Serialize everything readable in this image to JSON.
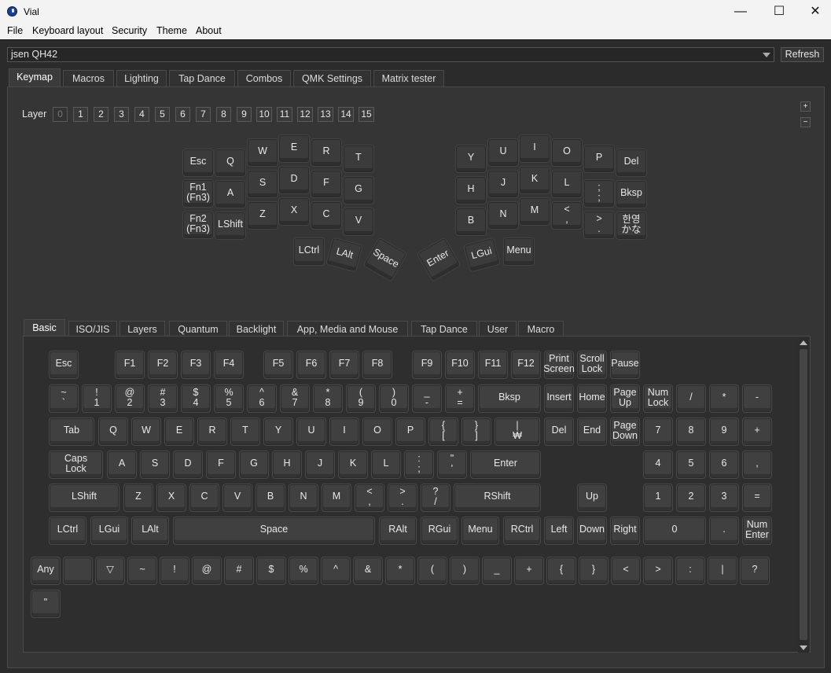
{
  "window": {
    "title": "Vial",
    "minimize": "—",
    "maximize": "☐",
    "close": "✕"
  },
  "menu": [
    "File",
    "Keyboard layout",
    "Security",
    "Theme",
    "About"
  ],
  "device": {
    "selected": "jsen QH42",
    "refresh_label": "Refresh"
  },
  "main_tabs": [
    "Keymap",
    "Macros",
    "Lighting",
    "Tap Dance",
    "Combos",
    "QMK Settings",
    "Matrix tester"
  ],
  "layer": {
    "label": "Layer",
    "buttons": [
      "0",
      "1",
      "2",
      "3",
      "4",
      "5",
      "6",
      "7",
      "8",
      "9",
      "10",
      "11",
      "12",
      "13",
      "14",
      "15"
    ],
    "active": 0,
    "plus": "+",
    "minus": "−"
  },
  "keymap_keys": {
    "left": [
      "Esc",
      "Q",
      "W",
      "E",
      "R",
      "T",
      "Fn1\n(Fn3)",
      "A",
      "S",
      "D",
      "F",
      "G",
      "Fn2\n(Fn3)",
      "LShift",
      "Z",
      "X",
      "C",
      "V",
      "LCtrl",
      "LAlt",
      "Space"
    ],
    "right": [
      "Y",
      "U",
      "I",
      "O",
      "P",
      "Del",
      "H",
      "J",
      "K",
      "L",
      ";\n;",
      "Bksp",
      "B",
      "N",
      "M",
      "<\n,",
      ">\n.",
      "한영\nかな",
      "Enter",
      "LGui",
      "Menu"
    ]
  },
  "palette_tabs": [
    "Basic",
    "ISO/JIS",
    "Layers",
    "Quantum",
    "Backlight",
    "App, Media and Mouse",
    "Tap Dance",
    "User",
    "Macro"
  ],
  "palette_rows": [
    [
      "Esc",
      "F1",
      "F2",
      "F3",
      "F4",
      "F5",
      "F6",
      "F7",
      "F8",
      "F9",
      "F10",
      "F11",
      "F12",
      "Print\nScreen",
      "Scroll\nLock",
      "Pause"
    ],
    [
      "~\n`",
      "!\n1",
      "@\n2",
      "#\n3",
      "$\n4",
      "%\n5",
      "^\n6",
      "&\n7",
      "*\n8",
      "(\n9",
      ")\n0",
      "_\n-",
      "+\n=",
      "Bksp",
      "Insert",
      "Home",
      "Page\nUp",
      "Num\nLock",
      "/",
      "*",
      "-"
    ],
    [
      "Tab",
      "Q",
      "W",
      "E",
      "R",
      "T",
      "Y",
      "U",
      "I",
      "O",
      "P",
      "{\n[",
      "}\n]",
      "|\n₩",
      "Del",
      "End",
      "Page\nDown",
      "7",
      "8",
      "9",
      "+"
    ],
    [
      "Caps\nLock",
      "A",
      "S",
      "D",
      "F",
      "G",
      "H",
      "J",
      "K",
      "L",
      ":\n;",
      "\"\n'",
      "Enter",
      "4",
      "5",
      "6",
      ","
    ],
    [
      "LShift",
      "Z",
      "X",
      "C",
      "V",
      "B",
      "N",
      "M",
      "<\n,",
      ">\n.",
      "?\n/",
      "RShift",
      "Up",
      "1",
      "2",
      "3",
      "="
    ],
    [
      "LCtrl",
      "LGui",
      "LAlt",
      "Space",
      "RAlt",
      "RGui",
      "Menu",
      "RCtrl",
      "Left",
      "Down",
      "Right",
      "0",
      ".",
      "Num\nEnter"
    ],
    [
      "Any",
      "",
      "▽",
      "~",
      "!",
      "@",
      "#",
      "$",
      "%",
      "^",
      "&",
      "*",
      "(",
      ")",
      "_",
      "+",
      "{",
      "}",
      "<",
      ">",
      ":",
      "|",
      "?"
    ],
    [
      "\""
    ]
  ]
}
